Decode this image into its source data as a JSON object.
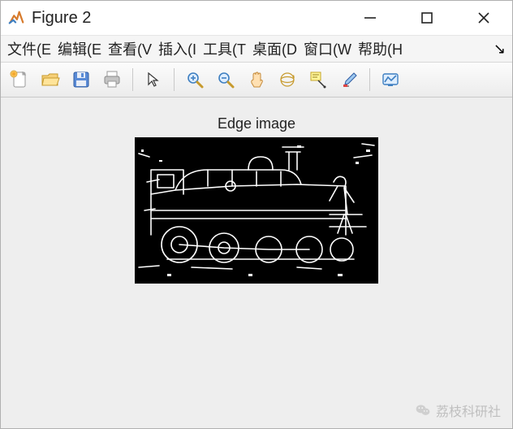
{
  "titlebar": {
    "title": "Figure 2"
  },
  "menus": {
    "items": [
      "文件(E",
      "编辑(E",
      "查看(V",
      "插入(I",
      "工具(T",
      "桌面(D",
      "窗口(W",
      "帮助(H"
    ],
    "overflow": "↘"
  },
  "toolbar": {
    "new_tip": "New Figure",
    "open_tip": "Open",
    "save_tip": "Save",
    "print_tip": "Print",
    "pointer_tip": "Edit Plot",
    "zoom_in_tip": "Zoom In",
    "zoom_out_tip": "Zoom Out",
    "pan_tip": "Pan",
    "rotate_tip": "Rotate 3D",
    "datacursor_tip": "Data Cursor",
    "brush_tip": "Brush",
    "link_tip": "Link Plot"
  },
  "figure": {
    "title": "Edge image"
  },
  "watermark": {
    "text": "荔枝科研社"
  }
}
